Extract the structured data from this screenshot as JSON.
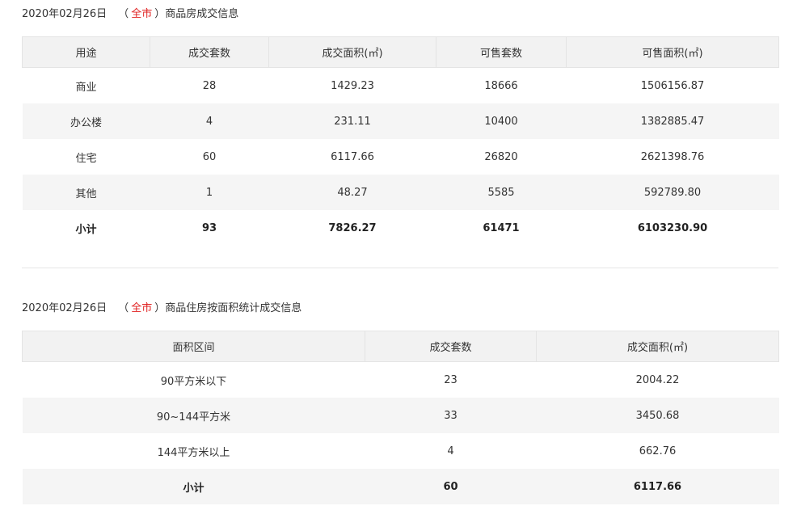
{
  "table1": {
    "title": {
      "date": "2020年02月26日",
      "open_paren": "（",
      "scope": "全市",
      "close_paren": "）",
      "name": "商品房成交信息"
    },
    "headers": [
      "用途",
      "成交套数",
      "成交面积(㎡)",
      "可售套数",
      "可售面积(㎡)"
    ],
    "rows": [
      [
        "商业",
        "28",
        "1429.23",
        "18666",
        "1506156.87"
      ],
      [
        "办公楼",
        "4",
        "231.11",
        "10400",
        "1382885.47"
      ],
      [
        "住宅",
        "60",
        "6117.66",
        "26820",
        "2621398.76"
      ],
      [
        "其他",
        "1",
        "48.27",
        "5585",
        "592789.80"
      ]
    ],
    "total": [
      "小计",
      "93",
      "7826.27",
      "61471",
      "6103230.90"
    ]
  },
  "table2": {
    "title": {
      "date": "2020年02月26日",
      "open_paren": "（",
      "scope": "全市",
      "close_paren": "）",
      "name": "商品住房按面积统计成交信息"
    },
    "headers": [
      "面积区间",
      "成交套数",
      "成交面积(㎡)"
    ],
    "rows": [
      [
        "90平方米以下",
        "23",
        "2004.22"
      ],
      [
        "90~144平方米",
        "33",
        "3450.68"
      ],
      [
        "144平方米以上",
        "4",
        "662.76"
      ]
    ],
    "total": [
      "小计",
      "60",
      "6117.66"
    ]
  },
  "colors": {
    "scope_accent": "#e02020",
    "header_bg": "#f2f2f2",
    "stripe_bg": "#f5f5f5",
    "divider": "#e6e6e6"
  }
}
